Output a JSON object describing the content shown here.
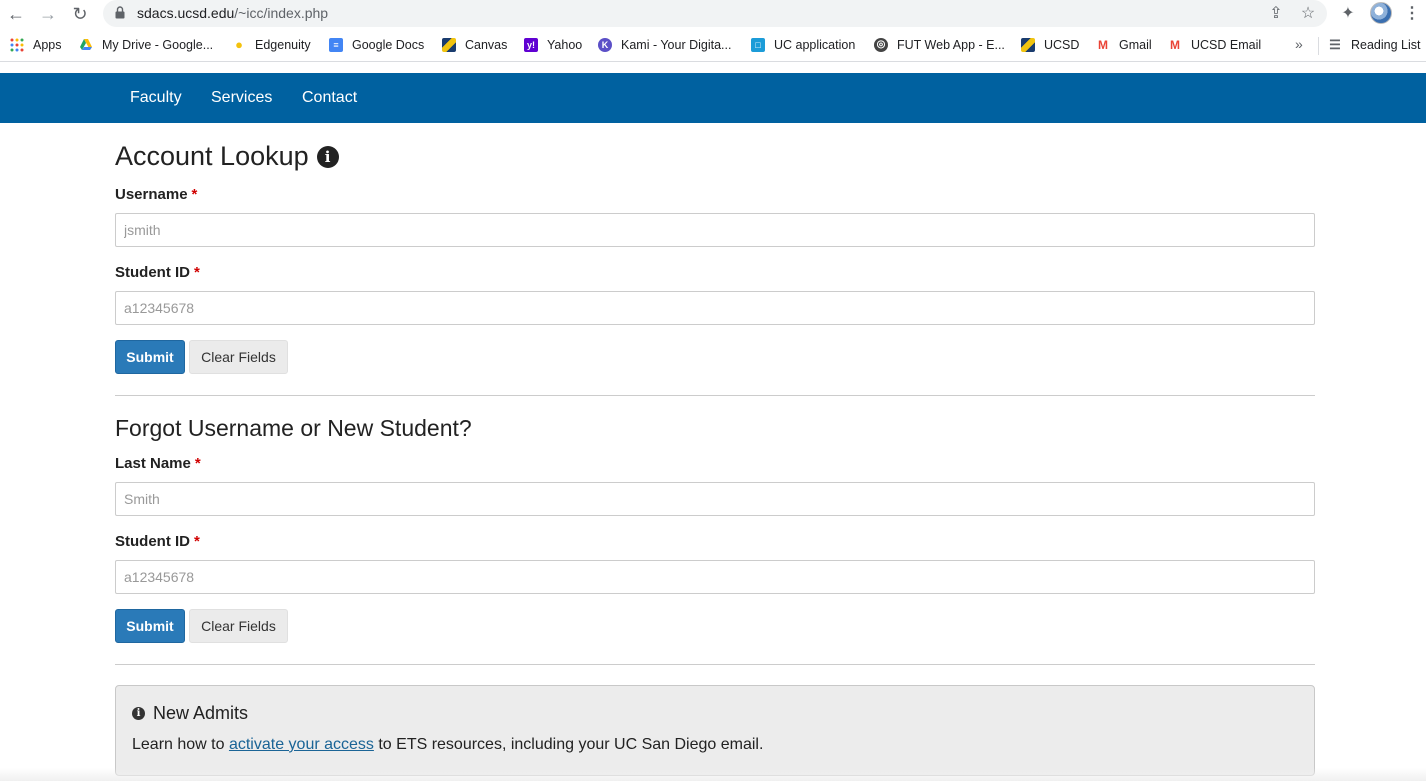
{
  "browser": {
    "url_host": "sdacs.ucsd.edu",
    "url_path": "/~icc/index.php",
    "bookmarks": [
      {
        "label": "Apps",
        "icon": "apps-grid-icon",
        "color": "#ea4335"
      },
      {
        "label": "My Drive - Google...",
        "icon": "google-drive-icon",
        "color": "#1fa463"
      },
      {
        "label": "Edgenuity",
        "icon": "lightbulb-icon",
        "color": "#f4c20d"
      },
      {
        "label": "Google Docs",
        "icon": "google-docs-icon",
        "color": "#4285f4"
      },
      {
        "label": "Canvas",
        "icon": "canvas-icon",
        "color": "#c7a318"
      },
      {
        "label": "Yahoo",
        "icon": "yahoo-icon",
        "color": "#6001d2"
      },
      {
        "label": "Kami - Your Digita...",
        "icon": "kami-icon",
        "color": "#5b4fc7"
      },
      {
        "label": "UC application",
        "icon": "uc-application-icon",
        "color": "#1c9cd8"
      },
      {
        "label": "FUT Web App - E...",
        "icon": "globe-icon",
        "color": "#444444"
      },
      {
        "label": "UCSD",
        "icon": "ucsd-icon",
        "color": "#c7a318"
      },
      {
        "label": "Gmail",
        "icon": "gmail-icon",
        "color": "#ea4335"
      },
      {
        "label": "UCSD Email",
        "icon": "gmail-icon",
        "color": "#ea4335"
      }
    ],
    "more_label": "»",
    "reading_list_label": "Reading List"
  },
  "site_nav": {
    "items": [
      "Faculty",
      "Services",
      "Contact"
    ],
    "color": "#0061a0"
  },
  "account_lookup": {
    "title": "Account Lookup",
    "username_label": "Username",
    "username_placeholder": "jsmith",
    "student_id_label": "Student ID",
    "student_id_placeholder": "a12345678",
    "submit_label": "Submit",
    "clear_label": "Clear Fields"
  },
  "forgot": {
    "title": "Forgot Username or New Student?",
    "last_name_label": "Last Name",
    "last_name_placeholder": "Smith",
    "student_id_label": "Student ID",
    "student_id_placeholder": "a12345678",
    "submit_label": "Submit",
    "clear_label": "Clear Fields"
  },
  "required_marker": "*",
  "notice": {
    "title": "New Admits",
    "text_before": "Learn how to ",
    "link_text": "activate your access",
    "text_after": " to ETS resources, including your UC San Diego email."
  }
}
